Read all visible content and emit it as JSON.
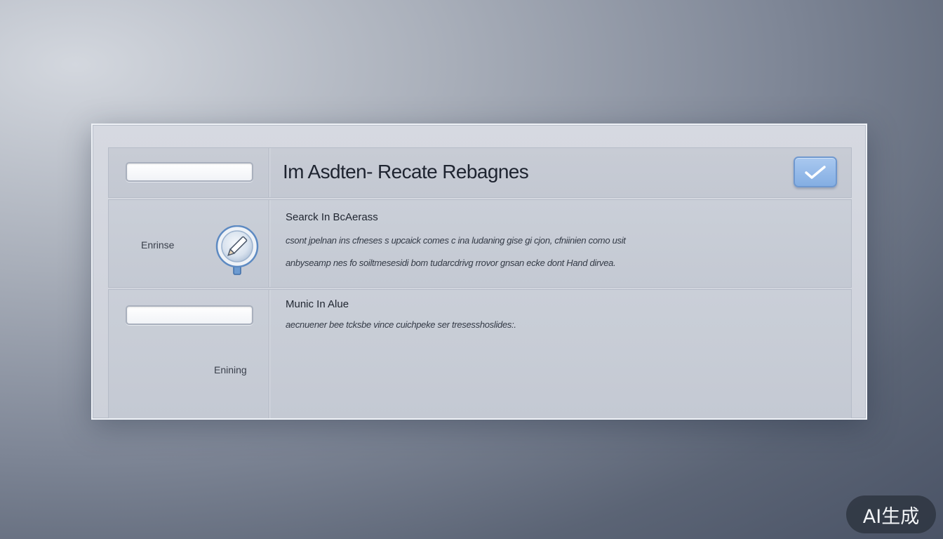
{
  "header": {
    "title": "Im Asdten- Recate Rebagnes",
    "input_value": ""
  },
  "row1": {
    "left_label": "Enrinse",
    "heading": "Searck In BcAerass",
    "line1": "csont jpelnan ins cfneses s upcaick comes c ina ludaning gise gi cjon, cfniinien como usit",
    "line2": "anbyseamp nes fo  soiltmesesidi bom tudarcdrivg rrovor gnsan ecke dont Hand dirvea."
  },
  "row2": {
    "input_value": "",
    "left_label": "Enining",
    "heading": "Munic In Alue",
    "line1": "aecnuener bee tcksbe vince cuichpeke ser tresesshoslides:."
  },
  "badge": {
    "text": "AI生成"
  },
  "colors": {
    "accent": "#84aee3",
    "accent_border": "#6f98cf",
    "panel": "#cacfd8"
  },
  "icons": {
    "confirm": "checkmark-icon",
    "search": "magnifier-pencil-icon"
  }
}
